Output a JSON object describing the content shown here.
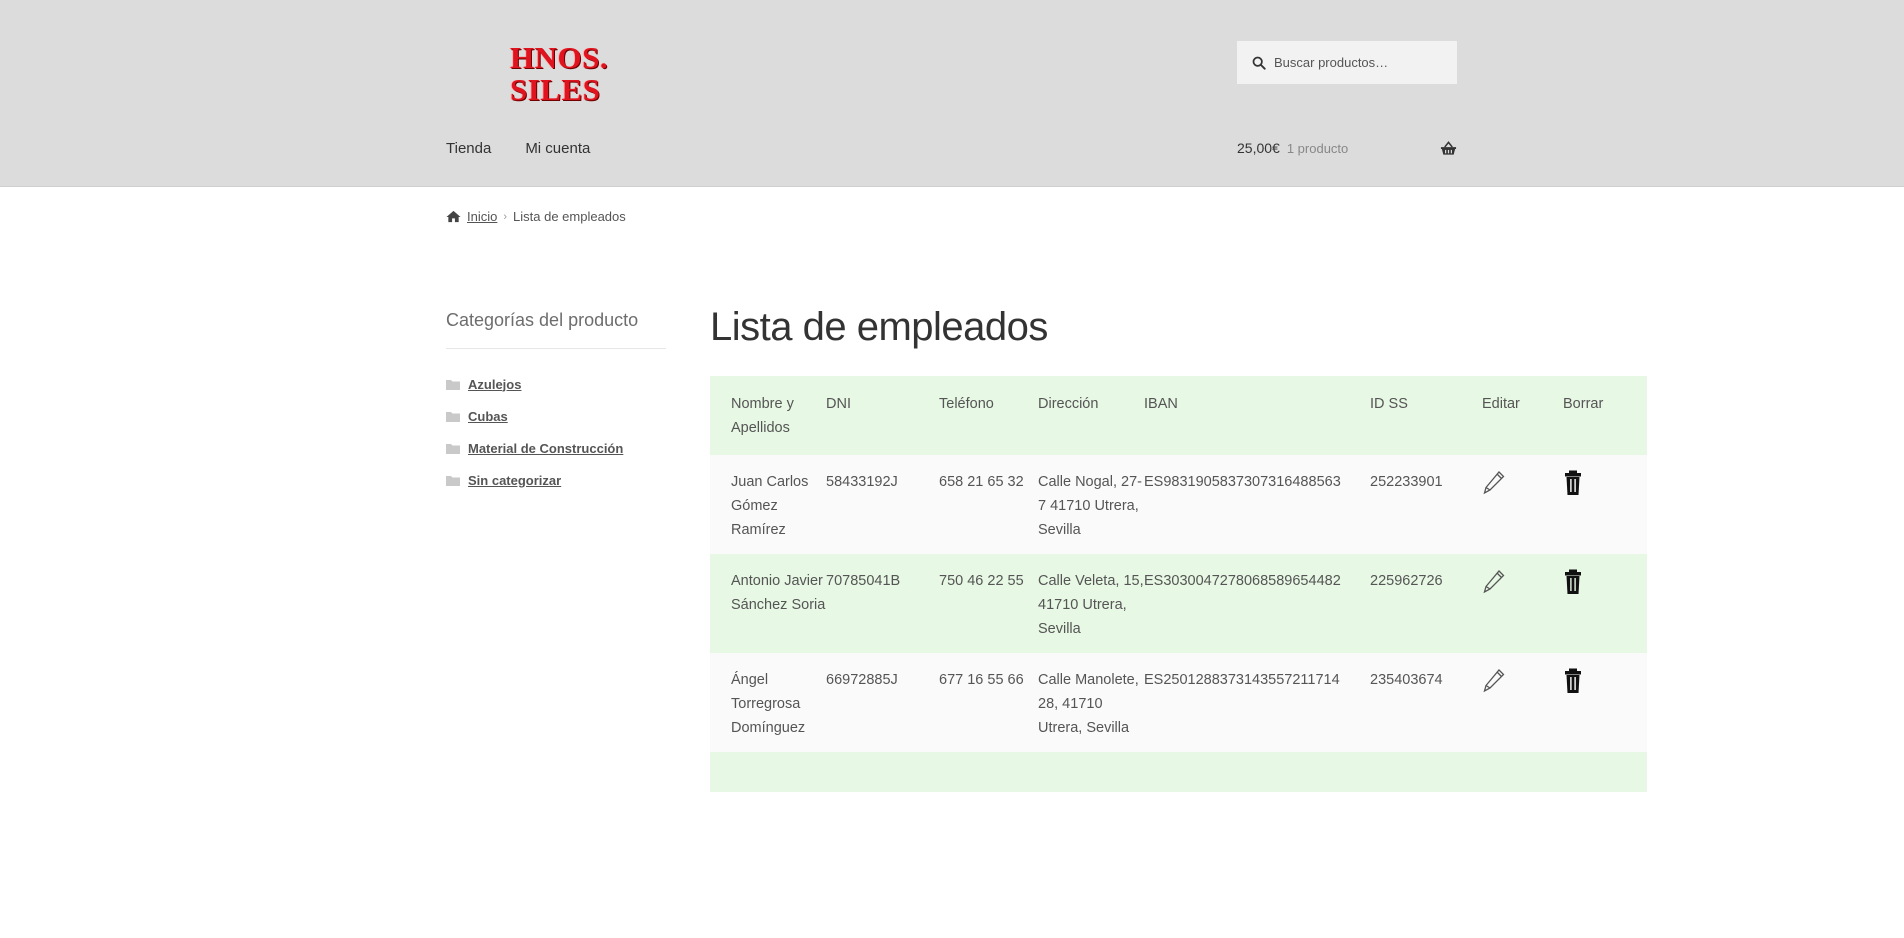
{
  "header": {
    "logo_line1": "HNOS.",
    "logo_line2": "SILES",
    "search_placeholder": "Buscar productos…",
    "nav": [
      "Tienda",
      "Mi cuenta"
    ],
    "cart_total": "25,00€",
    "cart_count": "1 producto"
  },
  "breadcrumb": {
    "home": "Inicio",
    "separator": "›",
    "current": "Lista de empleados"
  },
  "sidebar": {
    "title": "Categorías del producto",
    "categories": [
      "Azulejos",
      "Cubas",
      "Material de Construcción",
      "Sin categorizar"
    ]
  },
  "main": {
    "title": "Lista de empleados",
    "columns": [
      "Nombre y Apellidos",
      "DNI",
      "Teléfono",
      "Dirección",
      "IBAN",
      "ID SS",
      "Editar",
      "Borrar"
    ],
    "rows": [
      {
        "name": "Juan Carlos Gómez Ramírez",
        "dni": "58433192J",
        "tel": "658 21 65 32",
        "dir": "Calle Nogal, 27-7 41710 Utrera, Sevilla",
        "iban": "ES9831905837307316488563",
        "ss": "252233901"
      },
      {
        "name": "Antonio Javier Sánchez Soria",
        "dni": "70785041B",
        "tel": "750 46 22 55",
        "dir": "Calle Veleta, 15, 41710 Utrera, Sevilla",
        "iban": "ES3030047278068589654482",
        "ss": "225962726"
      },
      {
        "name": "Ángel Torregrosa Domínguez",
        "dni": "66972885J",
        "tel": "677 16 55 66",
        "dir": "Calle Manolete, 28, 41710 Utrera, Sevilla",
        "iban": "ES2501288373143557211714",
        "ss": "235403674"
      }
    ]
  },
  "icons": {
    "search": "search-icon",
    "cart": "basket-icon",
    "home": "home-icon",
    "folder": "folder-icon",
    "edit": "pencil-icon",
    "delete": "trash-icon"
  },
  "colors": {
    "header_bg": "#dcdcdc",
    "row_alt": "#e7f8e4",
    "row_plain": "#fafafa",
    "logo_red": "#e0141e"
  }
}
